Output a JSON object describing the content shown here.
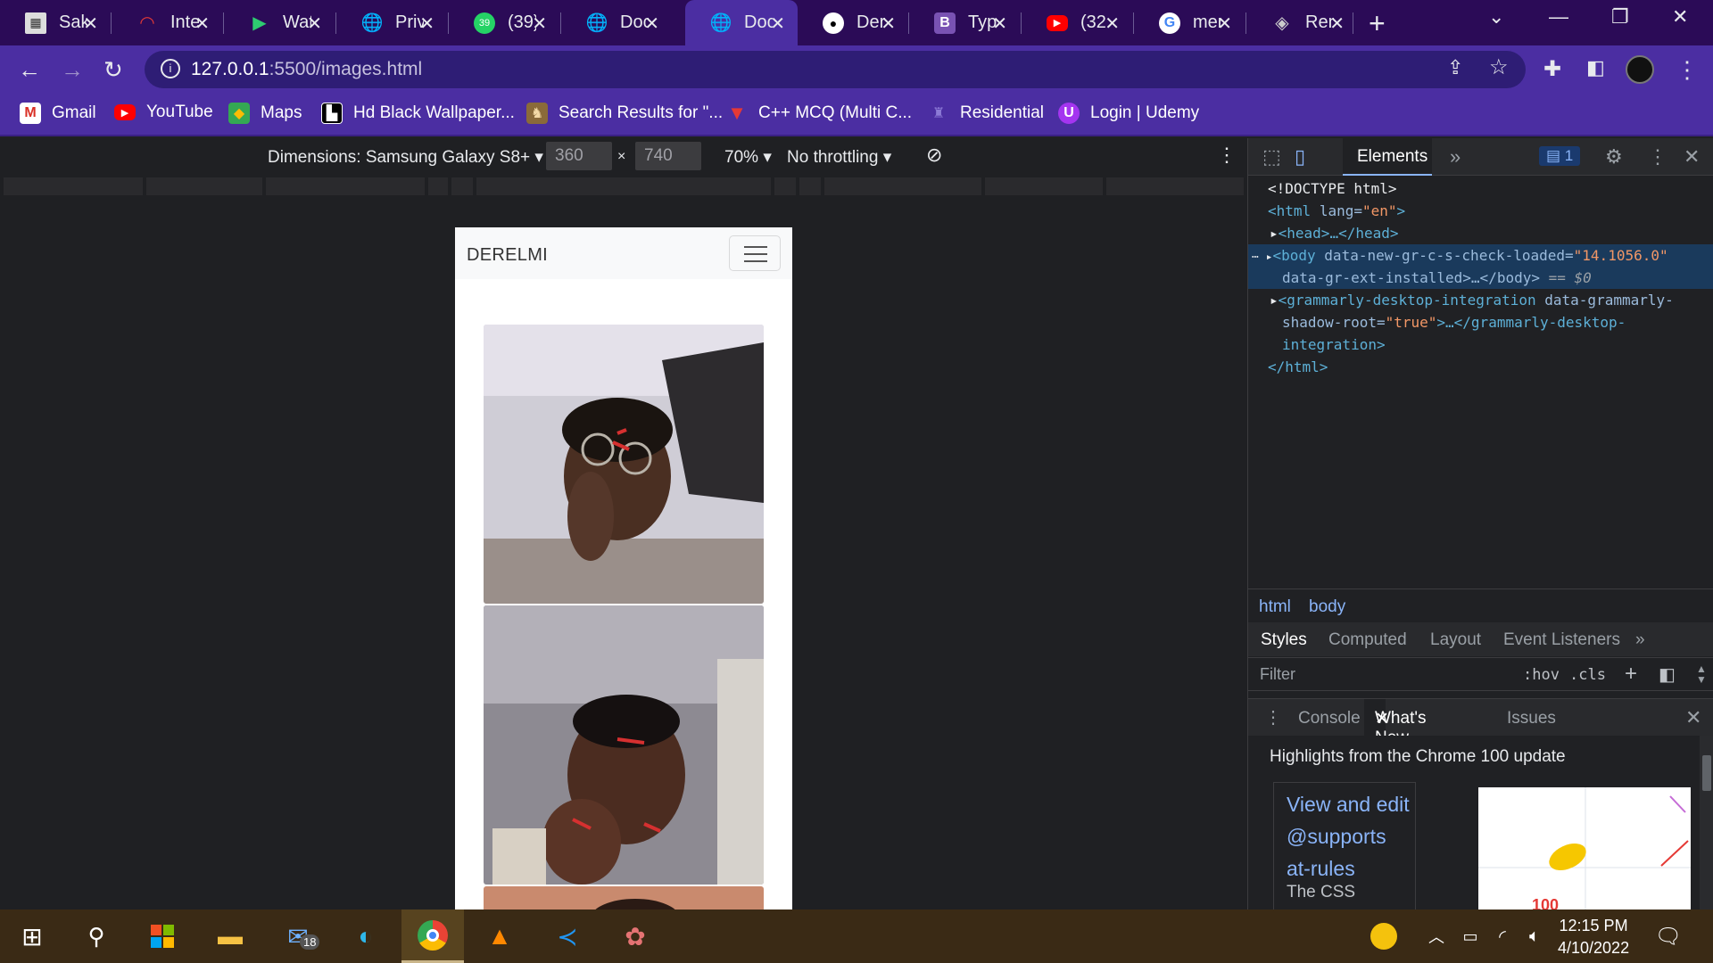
{
  "tabs": [
    {
      "title": "Sak",
      "icon": "page-icon"
    },
    {
      "title": "Inte",
      "icon": "gauge-icon"
    },
    {
      "title": "Wat",
      "icon": "play-icon"
    },
    {
      "title": "Priv",
      "icon": "globe-icon"
    },
    {
      "title": "(39)",
      "icon": "whatsapp-icon"
    },
    {
      "title": "Doc",
      "icon": "globe-icon"
    },
    {
      "title": "Doc",
      "icon": "globe-icon",
      "active": true
    },
    {
      "title": "Der",
      "icon": "github-icon"
    },
    {
      "title": "Typ",
      "icon": "bootstrap-icon"
    },
    {
      "title": "(32",
      "icon": "youtube-icon"
    },
    {
      "title": "mer",
      "icon": "google-icon"
    },
    {
      "title": "Ren",
      "icon": "layers-icon"
    }
  ],
  "address_bar": {
    "host": "127.0.0.1",
    "path": ":5500/images.html"
  },
  "bookmarks": [
    {
      "label": "Gmail",
      "icon": "gmail-icon"
    },
    {
      "label": "YouTube",
      "icon": "youtube-icon"
    },
    {
      "label": "Maps",
      "icon": "maps-icon"
    },
    {
      "label": "Hd Black Wallpaper...",
      "icon": "wallpaper-icon"
    },
    {
      "label": "Search Results for \"...",
      "icon": "search-results-icon"
    },
    {
      "label": "C++ MCQ (Multi C...",
      "icon": "shield-icon"
    },
    {
      "label": "Residential",
      "icon": "residential-icon"
    },
    {
      "label": "Login | Udemy",
      "icon": "udemy-icon"
    }
  ],
  "device_toolbar": {
    "dimensions": "Dimensions: Samsung Galaxy S8+",
    "width": "360",
    "times": "×",
    "height": "740",
    "zoom": "70%",
    "throttling": "No throttling"
  },
  "page": {
    "brand": "DERELMI"
  },
  "devtools": {
    "panel": "Elements",
    "issues_count": "1",
    "dom": {
      "doctype": "<!DOCTYPE html>",
      "html_open": "<html",
      "lang_attr": "lang=",
      "lang_val": "\"en\"",
      "head": "<head>…</head>",
      "body_tag": "<body",
      "body_attr1": "data-new-gr-c-s-check-loaded=",
      "body_val1": "\"14.1056.0\"",
      "body_attr2": "data-gr-ext-installed>…</body>",
      "body_eq": "== $0",
      "gram_tag": "<grammarly-desktop-integration",
      "gram_attr": "data-grammarly-",
      "gram_attr2": "shadow-root=",
      "gram_val": "\"true\"",
      "gram_close": ">…</grammarly-desktop-",
      "gram_close2": "integration>",
      "html_close": "</html>"
    },
    "breadcrumbs": [
      "html",
      "body"
    ],
    "styles_tabs": [
      "Styles",
      "Computed",
      "Layout",
      "Event Listeners"
    ],
    "filter_placeholder": "Filter",
    "hov": ":hov",
    "cls": ".cls",
    "drawer_tabs": [
      "Console",
      "What's New",
      "Issues"
    ],
    "whats_new": {
      "headline": "Highlights from the Chrome 100 update",
      "card_link": "View and edit @supports at-rules",
      "card_sub": "The CSS"
    }
  },
  "taskbar": {
    "badge": "18",
    "time": "12:15 PM",
    "date": "4/10/2022"
  }
}
